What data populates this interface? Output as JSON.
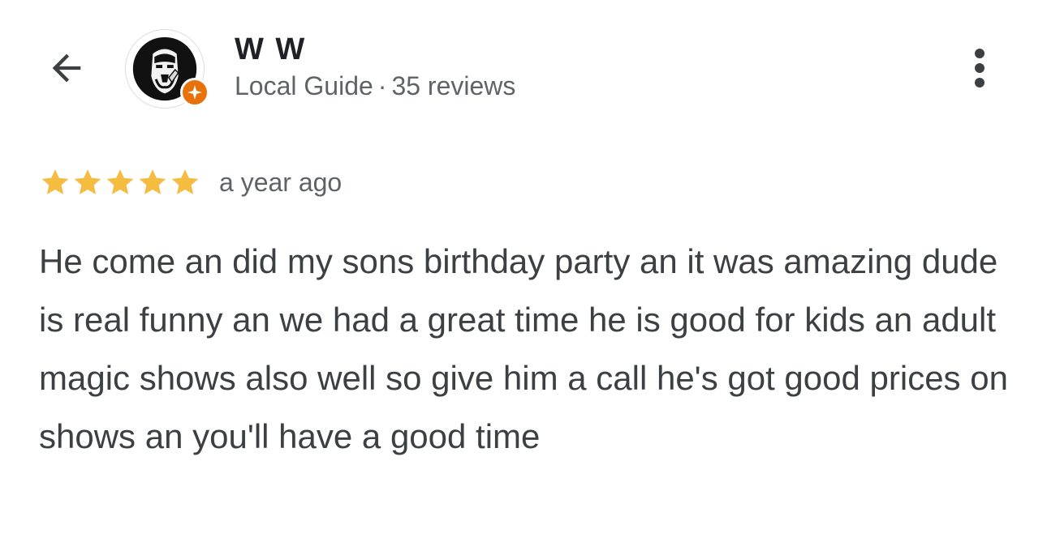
{
  "header": {
    "back_icon": "arrow-back-icon",
    "more_icon": "more-vert-icon"
  },
  "user": {
    "name": "W W",
    "level": "Local Guide",
    "separator": "·",
    "reviews": "35 reviews",
    "badge_icon": "local-guide-star-icon",
    "badge_color": "#e8710a"
  },
  "review": {
    "rating": 5,
    "max_rating": 5,
    "star_color": "#f4bd42",
    "date": "a year ago",
    "text": "He come an did my sons birthday party an it was amazing dude is real funny an we had a great time he is good for kids an adult magic shows also well so give him a call he's got good prices on shows an you'll have a good time"
  }
}
